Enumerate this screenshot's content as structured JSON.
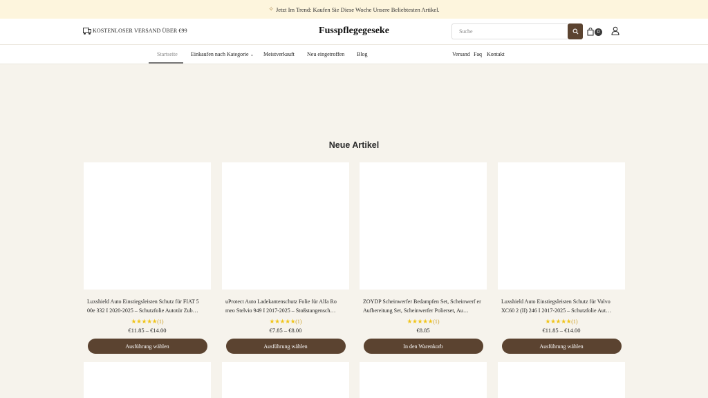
{
  "announcement": {
    "icon": "sparkle-icon",
    "text": "Jetzt Im Trend: Kaufen Sie Diese Woche Unsere Beliebtesten Artikel."
  },
  "header": {
    "shipping_text": "KOSTENLOSER VERSAND ÜBER €99",
    "brand": "Fusspflegegeseke",
    "search_placeholder": "Suche",
    "cart_count": "0"
  },
  "nav": {
    "left": [
      {
        "label": "Startseite",
        "active": true
      },
      {
        "label": "Einkaufen nach Kategorie",
        "has_dropdown": true
      },
      {
        "label": "Meistverkauft"
      },
      {
        "label": "Neu eingetroffen"
      },
      {
        "label": "Blog"
      }
    ],
    "right": [
      {
        "label": "Versand"
      },
      {
        "label": "Faq"
      },
      {
        "label": "Kontakt"
      }
    ]
  },
  "section": {
    "title": "Neue Artikel"
  },
  "products": [
    {
      "title": "Luxshield Auto Einstiegsleisten Schutz für FIAT 5 00e 332 I 2020-2025 – Schutzfolie Autotür Zub…",
      "stars": "★★★★★",
      "rating_count": "(1)",
      "price": "€11.85 – €14.00",
      "action": "Ausführung wählen"
    },
    {
      "title": "uProtect Auto Ladekantenschutz Folie für Alfa Ro meo Stelvio 949 I 2017-2025 – Stoßstangensch…",
      "stars": "★★★★★",
      "rating_count": "(1)",
      "price": "€7.85 – €8.00",
      "action": "Ausführung wählen"
    },
    {
      "title": "ZOYDP Scheinwerfer Bedampfen Set, Scheinwerf er Aufbereitung Set, Scheinwerfer Polierset, Au…",
      "stars": "★★★★★",
      "rating_count": "(1)",
      "price": "€8.85",
      "action": "In den Warenkorb"
    },
    {
      "title": "Luxshield Auto Einstiegsleisten Schutz für Volvo XC60 2 (II) 246 I 2017-2025 – Schutzfolie Aut…",
      "stars": "★★★★★",
      "rating_count": "(1)",
      "price": "€11.85 – €14.00",
      "action": "Ausführung wählen"
    }
  ],
  "colors": {
    "page_bg": "#f6f3ec",
    "announcement_bg": "#fdf5dd",
    "accent_brown": "#5b4330",
    "star_yellow": "#f0c419"
  }
}
